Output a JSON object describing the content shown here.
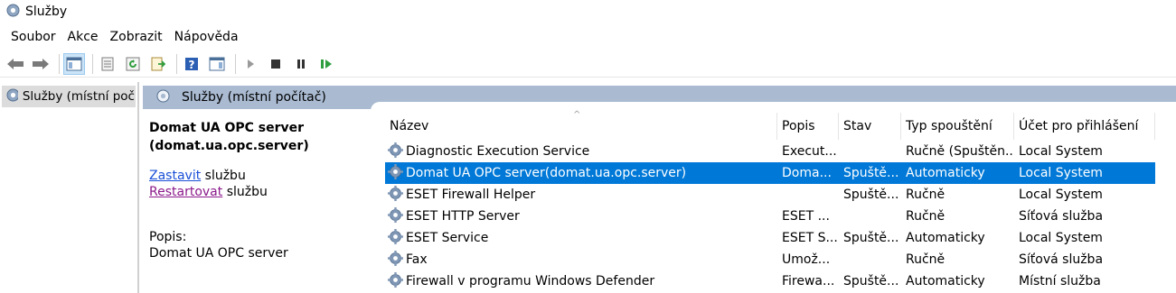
{
  "window": {
    "title": "Služby",
    "icon": "services-gear-icon"
  },
  "menu": [
    "Soubor",
    "Akce",
    "Zobrazit",
    "Nápověda"
  ],
  "toolbar": {
    "buttons": [
      "back-arrow-icon",
      "forward-arrow-icon",
      "show-console-tree-icon",
      "properties-icon",
      "refresh-icon",
      "export-list-icon",
      "help-icon",
      "show-action-pane-icon",
      "start-service-icon",
      "stop-service-icon",
      "pause-service-icon",
      "resume-service-icon"
    ]
  },
  "tree": {
    "root_label": "Služby (místní počítač)"
  },
  "main": {
    "header_title": "Služby (místní počítač)"
  },
  "detail": {
    "service_name": "Domat UA OPC server (domat.ua.opc.server)",
    "stop_link": "Zastavit",
    "stop_suffix": " službu",
    "restart_link": "Restartovat",
    "restart_suffix": " službu",
    "description_label": "Popis:",
    "description_text": "Domat UA OPC server"
  },
  "columns": {
    "name": "Název",
    "popis": "Popis",
    "stav": "Stav",
    "typ": "Typ spouštění",
    "ucet": "Účet pro přihlášení"
  },
  "rows": [
    {
      "name": "Diagnostic Execution Service",
      "popis": "Execut...",
      "stav": "",
      "typ": "Ručně (Spuštěn...",
      "ucet": "Local System",
      "selected": false
    },
    {
      "name": "Domat UA OPC server(domat.ua.opc.server)",
      "popis": "Doma...",
      "stav": "Spuště...",
      "typ": "Automaticky",
      "ucet": "Local System",
      "selected": true
    },
    {
      "name": "ESET Firewall Helper",
      "popis": "",
      "stav": "Spuště...",
      "typ": "Ručně",
      "ucet": "Local System",
      "selected": false
    },
    {
      "name": "ESET HTTP Server",
      "popis": "ESET ...",
      "stav": "",
      "typ": "Ručně",
      "ucet": "Síťová služba",
      "selected": false
    },
    {
      "name": "ESET Service",
      "popis": "ESET S...",
      "stav": "Spuště...",
      "typ": "Automaticky",
      "ucet": "Local System",
      "selected": false
    },
    {
      "name": "Fax",
      "popis": "Umož...",
      "stav": "",
      "typ": "Ručně",
      "ucet": "Síťová služba",
      "selected": false
    },
    {
      "name": "Firewall v programu Windows Defender",
      "popis": "Firewa...",
      "stav": "Spuště...",
      "typ": "Automaticky",
      "ucet": "Místní služba",
      "selected": false
    }
  ],
  "colors": {
    "selection": "#0078d7",
    "header_band": "#a9bad1",
    "link": "#1a4fd6",
    "visited_link": "#8b1a8b",
    "run_green": "#2e9e3e"
  }
}
